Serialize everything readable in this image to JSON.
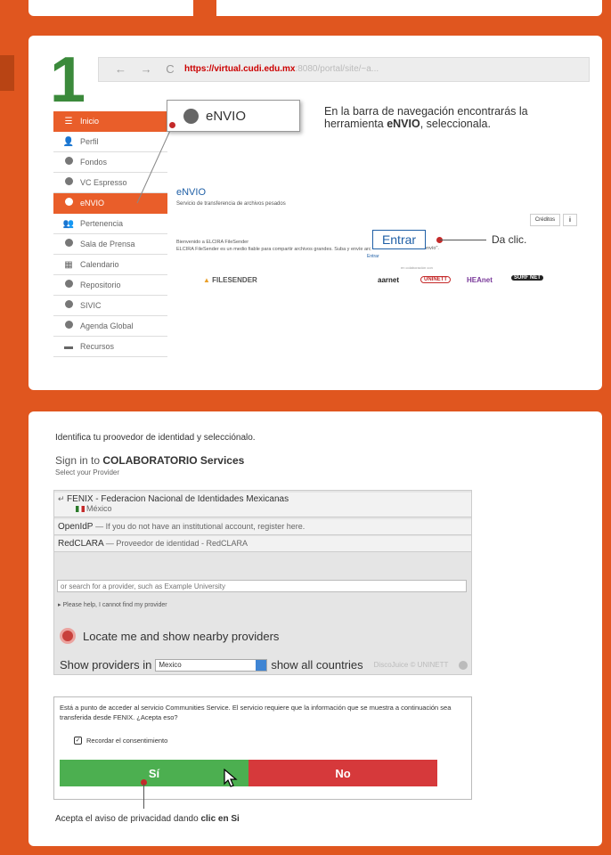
{
  "step": {
    "number": "1"
  },
  "browser": {
    "nav": "← → C",
    "url_main": "https://virtual.cudi.edu.mx",
    "url_rest": ":8080/portal/site/~a..."
  },
  "menu": {
    "items": [
      {
        "label": "Inicio",
        "icon": "list-icon"
      },
      {
        "label": "Perfil",
        "icon": "user-icon"
      },
      {
        "label": "Fondos",
        "icon": "globe-icon"
      },
      {
        "label": "VC Espresso",
        "icon": "globe-icon"
      },
      {
        "label": "eNVIO",
        "icon": "globe-icon"
      },
      {
        "label": "Pertenencia",
        "icon": "users-icon"
      },
      {
        "label": "Sala de Prensa",
        "icon": "globe-icon"
      },
      {
        "label": "Calendario",
        "icon": "calendar-icon"
      },
      {
        "label": "Repositorio",
        "icon": "globe-icon"
      },
      {
        "label": "SIVIC",
        "icon": "globe-icon"
      },
      {
        "label": "Agenda Global",
        "icon": "globe-icon"
      },
      {
        "label": "Recursos",
        "icon": "folder-icon"
      }
    ]
  },
  "callout": {
    "envio": "eNVIO",
    "instr_pre": "En la barra de navegación encontrarás la herramienta ",
    "instr_bold": "eNVIO",
    "instr_post": ", seleccionala."
  },
  "envio_page": {
    "title": "eNVIO",
    "subtitle": "Servicio de transferencia de archivos pesados",
    "credits": "Créditos",
    "info": "i",
    "welcome": "Bienvenido a ELCIRA FileSender\nELCIRA FileSender es un medio fiable para compartir archivos grandes. Suba y envíe arc",
    "welcome_tail": "envío\".",
    "entrar_small": "Entrar",
    "entrar": "Entrar",
    "da_clic": "Da clic.",
    "colab": "en colaboración con",
    "logos": [
      "FILESENDER",
      "aarnet",
      "UNINETT",
      "HEAnet",
      "SURF NET"
    ]
  },
  "idp": {
    "instruction": "Identifica tu proovedor de identidad y selecciónalo.",
    "signin_pre": "Sign in to ",
    "signin_bold": "COLABORATORIO Services",
    "select": "Select your Provider",
    "providers": [
      {
        "name": "FENIX - Federacion Nacional de Identidades Mexicanas",
        "country": "México"
      },
      {
        "name": "OpenIdP",
        "desc": "— If you do not have an institutional account, register here."
      },
      {
        "name": "RedCLARA",
        "desc": "— Proveedor de identidad - RedCLARA"
      }
    ],
    "search_placeholder": "or search for a provider, such as Example University",
    "help": "Please help, I cannot find my provider",
    "locate": "Locate me and show nearby providers",
    "show_in": "Show providers in",
    "country": "Mexico",
    "show_all": "show all countries",
    "disco": "DiscoJuice © UNINETT"
  },
  "consent": {
    "text": "Está a punto de acceder al servicio Communities Service. El servicio requiere que la información que se muestra a continuación sea transferida desde FENIX. ¿Acepta eso?",
    "remember": "Recordar el consentimiento",
    "yes": "Sí",
    "no": "No",
    "accept_pre": "Acepta el aviso de privacidad dando ",
    "accept_bold": "clic en Si"
  },
  "colors": {
    "background": "#e0561f",
    "accent": "#e95e2a",
    "link": "#1f5fa6",
    "yes": "#4caf50",
    "no": "#d6393b"
  }
}
